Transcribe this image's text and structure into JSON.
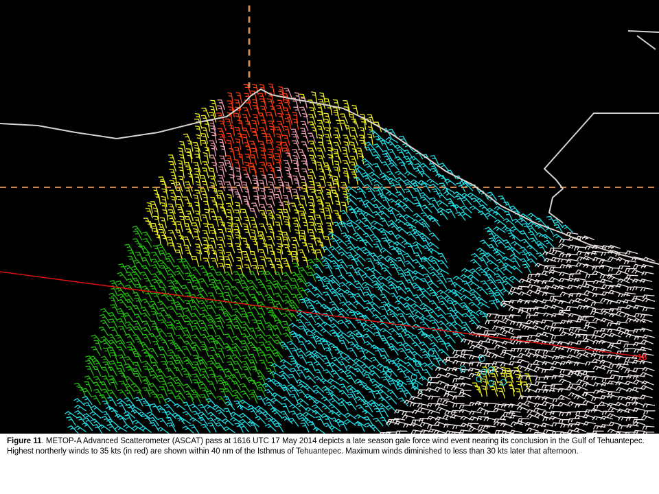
{
  "figure": {
    "label": "Figure 11",
    "caption": ". METOP-A Advanced Scatterometer (ASCAT) pass at 1616 UTC 17 May 2014 depicts a late season gale force wind event nearing its conclusion in the Gulf of Tehuantepec. Highest northerly winds to 35 kts (in red) are shown within 40 nm of the Isthmus of Tehuantepec.  Maximum winds diminished to less than 30 kts later that afternoon."
  },
  "map": {
    "background": "#000000",
    "coastline_color": "#d9d4d0",
    "graticule_color": "#d08a50",
    "track_line_color": "#e01010",
    "track_label": "16",
    "wind_speed_colors": {
      "highest_35kt": "#ff3a10",
      "high": "#f0a0b0",
      "moderate": "#f0f020",
      "light": "#22c010",
      "lighter": "#20e0e8",
      "lightest": "#f4ecec"
    }
  }
}
